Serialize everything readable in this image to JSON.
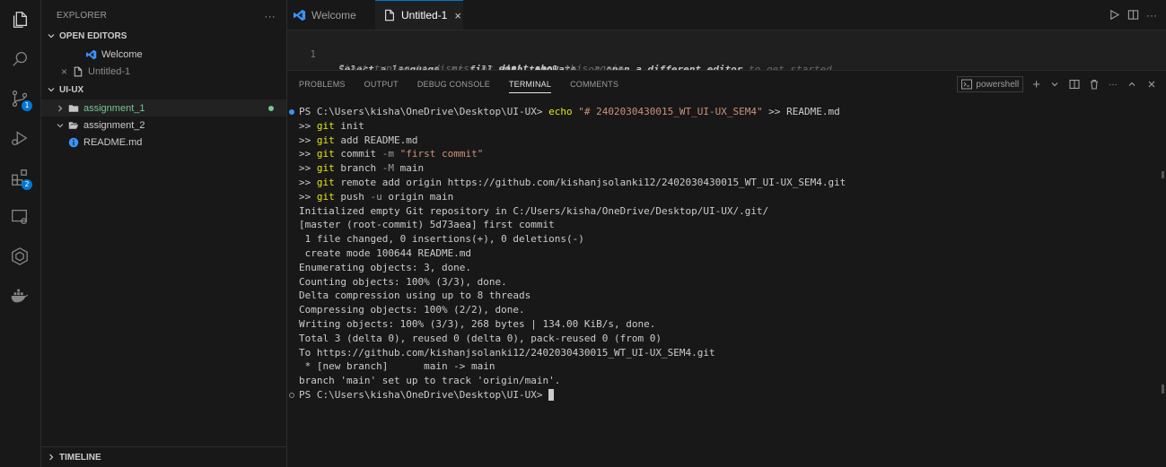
{
  "sidebar": {
    "title": "EXPLORER",
    "more": "···",
    "open_editors": {
      "label": "OPEN EDITORS",
      "items": [
        "Welcome",
        "Untitled-1"
      ]
    },
    "folder": {
      "label": "UI-UX",
      "items": [
        "assignment_1",
        "assignment_2",
        "README.md"
      ]
    },
    "timeline_label": "TIMELINE"
  },
  "tabs": [
    {
      "label": "Welcome"
    },
    {
      "label": "Untitled-1",
      "close": "×"
    }
  ],
  "editor": {
    "line_number": "1",
    "hint_line1": {
      "p1": "Select a language",
      "p2": ", or ",
      "p3": "fill with template",
      "p4": ", or ",
      "p5": "open a different editor",
      "p6": " to get started."
    },
    "hint_line2": {
      "p1": "Start typing to dismiss or ",
      "p2": "don't show",
      "p3": " this again."
    }
  },
  "panel": {
    "tabs": [
      "PROBLEMS",
      "OUTPUT",
      "DEBUG CONSOLE",
      "TERMINAL",
      "COMMENTS"
    ],
    "active_tab": "TERMINAL",
    "shell": "powershell"
  },
  "terminal": {
    "prompt": "PS C:\\Users\\kisha\\OneDrive\\Desktop\\UI-UX>",
    "cmd_echo": {
      "kw": "echo",
      "arg": "\"# 2402030430015_WT_UI-UX_SEM4\"",
      "rest": ">> README.md"
    },
    "cmds": [
      {
        "kw": "git",
        "rest": "init"
      },
      {
        "kw": "git",
        "rest": "add README.md"
      },
      {
        "kw": "git",
        "sub": "commit",
        "flag": "-m",
        "arg": "\"first commit\""
      },
      {
        "kw": "git",
        "sub": "branch",
        "flag": "-M",
        "rest": "main"
      },
      {
        "kw": "git",
        "sub": "remote",
        "rest": "add origin https://github.com/kishanjsolanki12/2402030430015_WT_UI-UX_SEM4.git"
      },
      {
        "kw": "git",
        "sub": "push",
        "flag": "-u",
        "rest": "origin main"
      }
    ],
    "cont": ">>",
    "output": [
      "Initialized empty Git repository in C:/Users/kisha/OneDrive/Desktop/UI-UX/.git/",
      "[master (root-commit) 5d73aea] first commit",
      " 1 file changed, 0 insertions(+), 0 deletions(-)",
      " create mode 100644 README.md",
      "Enumerating objects: 3, done.",
      "Counting objects: 100% (3/3), done.",
      "Delta compression using up to 8 threads",
      "Compressing objects: 100% (2/2), done.",
      "Writing objects: 100% (3/3), 268 bytes | 134.00 KiB/s, done.",
      "Total 3 (delta 0), reused 0 (delta 0), pack-reused 0 (from 0)",
      "To https://github.com/kishanjsolanki12/2402030430015_WT_UI-UX_SEM4.git",
      " * [new branch]      main -> main",
      "branch 'main' set up to track 'origin/main'."
    ]
  },
  "colors": {
    "accent": "#0078d4",
    "git_added": "#73c991",
    "terminal_keyword": "#e5e510",
    "decoration_success": "#3794ff"
  }
}
